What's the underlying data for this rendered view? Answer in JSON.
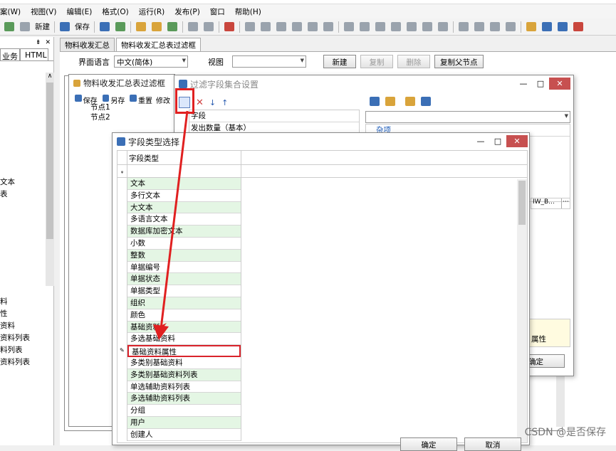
{
  "menu": [
    "案(W)",
    "视图(V)",
    "编辑(E)",
    "格式(O)",
    "运行(R)",
    "发布(P)",
    "窗口",
    "帮助(H)"
  ],
  "toolbar": {
    "new_label": "新建",
    "save_label": "保存"
  },
  "left_panel": {
    "tabs": [
      "业务",
      "HTML"
    ],
    "labels": [
      "文本",
      "表",
      "料",
      "性",
      "资料",
      "资料列表",
      "料列表",
      "资料列表"
    ]
  },
  "doc_tabs": [
    "物料收发汇总",
    "物料收发汇总表过滤框"
  ],
  "top_row": {
    "lang_label": "界面语言",
    "lang_value": "中文(简体)",
    "view_label": "视图",
    "view_value": "",
    "buttons": [
      "新建",
      "复制",
      "删除",
      "复制父节点"
    ]
  },
  "filter_window": {
    "title": "物料收发汇总表过滤框",
    "tools": [
      "保存",
      "另存",
      "重置",
      "修改"
    ],
    "nodes": [
      "节点1",
      "节点2"
    ]
  },
  "field_collection": {
    "title": "过滤字段集合设置",
    "grid_header": "字段",
    "grid_row1": "发出数量（基本）",
    "right_item": "杂项",
    "right_cell": "IW_B...",
    "right_cell_btn": "···",
    "attr_label": "属性",
    "ok_partial": "确定"
  },
  "field_type_dialog": {
    "title": "字段类型选择",
    "column_header": "字段类型",
    "items": [
      "文本",
      "多行文本",
      "大文本",
      "多语言文本",
      "数据库加密文本",
      "小数",
      "整数",
      "单据编号",
      "单据状态",
      "单据类型",
      "组织",
      "颜色",
      "基础资料",
      "多选基础资料",
      "基础资料属性",
      "多类别基础资料",
      "多类别基础资料列表",
      "单选辅助资料列表",
      "多选辅助资料列表",
      "分组",
      "用户",
      "创建人"
    ],
    "selected_index": 14,
    "confirm": "确定",
    "cancel": "取消"
  },
  "watermark": "CSDN @是否保存"
}
